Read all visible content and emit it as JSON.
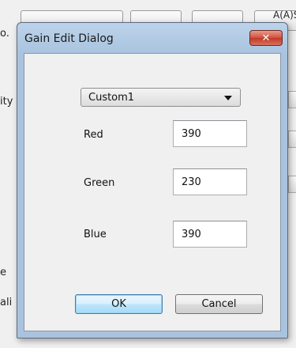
{
  "background": {
    "labels": [
      "o.",
      "ity",
      "e",
      "ali"
    ],
    "right_text": "A(A)S"
  },
  "dialog": {
    "title": "Gain Edit Dialog",
    "close_symbol": "✕",
    "preset": {
      "value": "Custom1"
    },
    "fields": [
      {
        "label": "Red",
        "value": "390"
      },
      {
        "label": "Green",
        "value": "230"
      },
      {
        "label": "Blue",
        "value": "390"
      }
    ],
    "ok_label": "OK",
    "cancel_label": "Cancel"
  },
  "colors": {
    "titlebar": "#a9c3df",
    "close_button": "#c03a26",
    "ok_button_focus": "#3c7fb1"
  }
}
